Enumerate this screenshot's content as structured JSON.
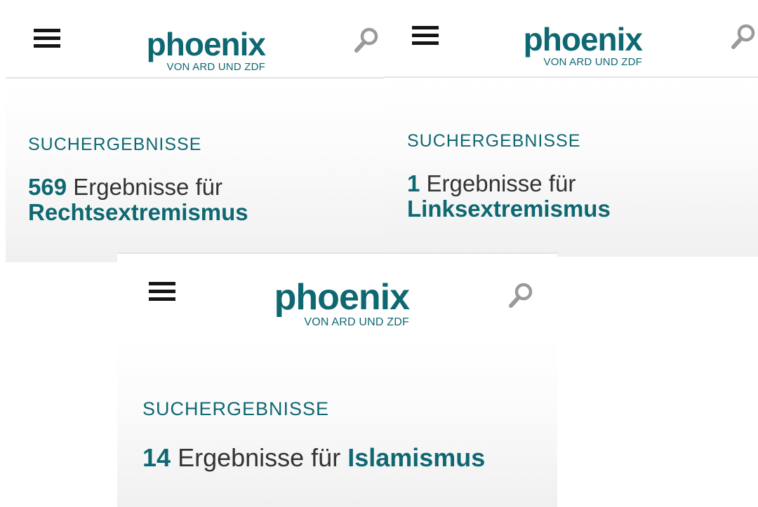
{
  "panels": [
    {
      "logo": {
        "name": "phoenix",
        "subtitle": "VON ARD UND ZDF"
      },
      "section_label": "SUCHERGEBNISSE",
      "result_count": "569",
      "result_text": "Ergebnisse für",
      "search_term": "Rechtsextremismus"
    },
    {
      "logo": {
        "name": "phoenix",
        "subtitle": "VON ARD UND ZDF"
      },
      "section_label": "SUCHERGEBNISSE",
      "result_count": "1",
      "result_text": "Ergebnisse für",
      "search_term": "Linksextremismus"
    },
    {
      "logo": {
        "name": "phoenix",
        "subtitle": "VON ARD UND ZDF"
      },
      "section_label": "SUCHERGEBNISSE",
      "result_count": "14",
      "result_text": "Ergebnisse für",
      "search_term": "Islamismus"
    }
  ],
  "icons": {
    "menu": "hamburger-menu-icon",
    "search": "search-magnifier-icon"
  },
  "colors": {
    "brand": "#0e6872",
    "text": "#333333",
    "icon_dark": "#151515",
    "icon_grey": "#9a9a9a"
  }
}
